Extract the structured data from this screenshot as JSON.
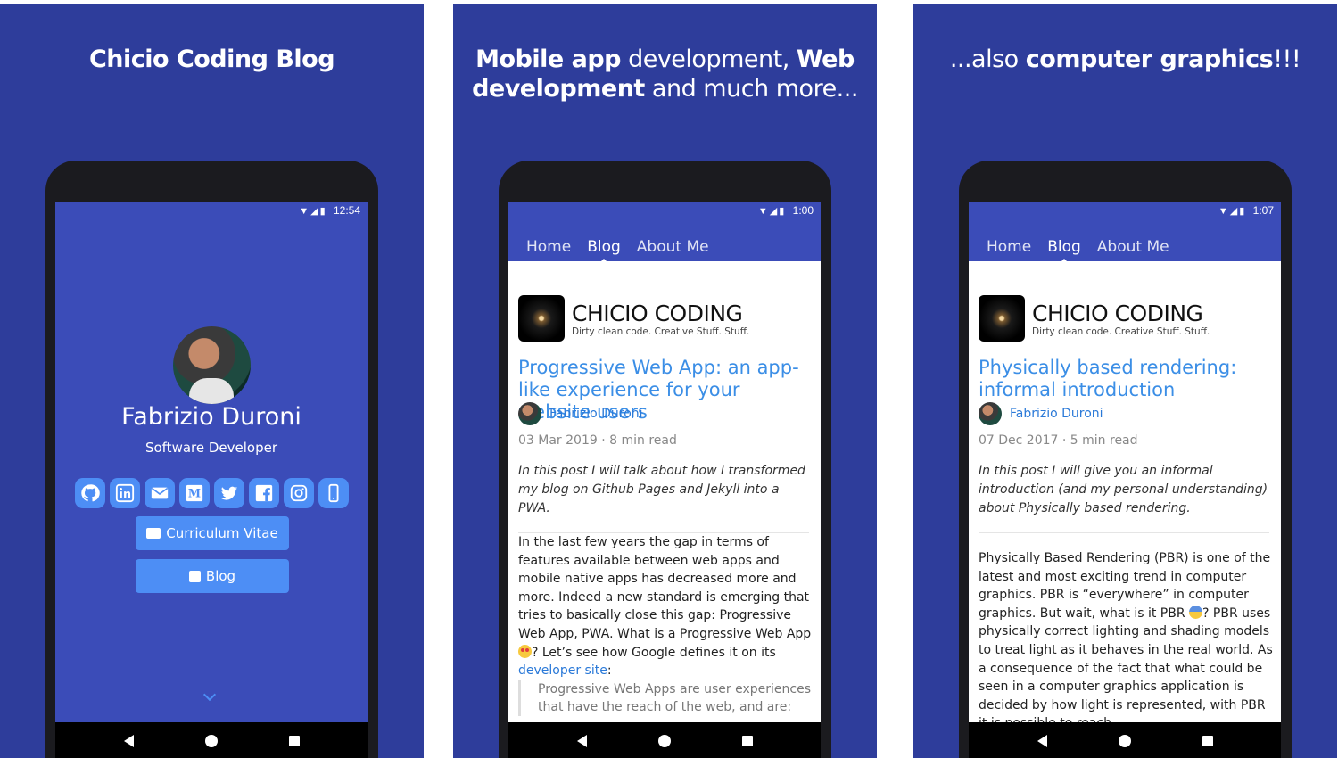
{
  "panels": [
    {
      "headline_parts": [
        {
          "text": "Chicio Coding Blog",
          "bold": true
        }
      ],
      "status_time": "12:54",
      "profile": {
        "name": "Fabrizio Duroni",
        "role": "Software Developer",
        "social_icons": [
          "github-icon",
          "linkedin-icon",
          "email-icon",
          "medium-icon",
          "twitter-icon",
          "facebook-icon",
          "instagram-icon",
          "mobile-icon"
        ],
        "medium_letter": "M",
        "cv_button": "Curriculum Vitae",
        "blog_button": "Blog"
      }
    },
    {
      "headline_parts": [
        {
          "text": "Mobile app",
          "bold": true
        },
        {
          "text": " development, ",
          "bold": false
        },
        {
          "text": "Web development",
          "bold": true
        },
        {
          "text": " and much more...",
          "bold": false
        }
      ],
      "status_time": "1:00",
      "tabs": [
        "Home",
        "Blog",
        "About Me"
      ],
      "active_tab": "Blog",
      "blog": {
        "logo_title": "CHICIO CODING",
        "logo_subtitle": "Dirty clean code. Creative Stuff. Stuff.",
        "post_title": "Progressive Web App: an app-like experience for your website users",
        "author": "Fabrizio Duroni",
        "meta": "03 Mar 2019 · 8 min read",
        "excerpt": "In this post I will talk about how I transformed my blog on Github Pages and Jekyll into a PWA.",
        "body_before_emoji": "In the last few years the gap in terms of features available between web apps and mobile native apps has decreased more and more. Indeed a new standard is emerging that tries to basically close this gap: Progressive Web App, PWA. What is a Progressive Web App ",
        "body_after_emoji": "? Let’s see how Google defines it on its ",
        "body_link": "developer site",
        "body_end": ":",
        "quote": "Progressive Web Apps are user experiences that have the reach of the web, and are:"
      }
    },
    {
      "headline_parts": [
        {
          "text": "...also ",
          "bold": false
        },
        {
          "text": "computer graphics",
          "bold": true
        },
        {
          "text": "!!!",
          "bold": false
        }
      ],
      "status_time": "1:07",
      "tabs": [
        "Home",
        "Blog",
        "About Me"
      ],
      "active_tab": "Blog",
      "blog": {
        "logo_title": "CHICIO CODING",
        "logo_subtitle": "Dirty clean code. Creative Stuff. Stuff.",
        "post_title": "Physically based rendering: informal introduction",
        "author": "Fabrizio Duroni",
        "meta": "07 Dec 2017 · 5 min read",
        "excerpt": "In this post I will give you an informal introduction (and my personal understanding) about Physically based rendering.",
        "body_before_emoji": "Physically Based Rendering (PBR) is one of the latest and most exciting trend in computer graphics. PBR is “everywhere” in computer graphics. But wait, what is it PBR ",
        "body_after_emoji": "? PBR uses physically correct lighting and shading models to treat light as it behaves in the real world. As a consequence of the fact that what could be seen in a computer graphics application is decided by how light is represented, with PBR it is possible to reach"
      }
    }
  ],
  "colors": {
    "panel_bg": "#2e3d9b",
    "app_blue": "#3b4cb8",
    "accent": "#4d8ef5",
    "link": "#2a79d8"
  }
}
